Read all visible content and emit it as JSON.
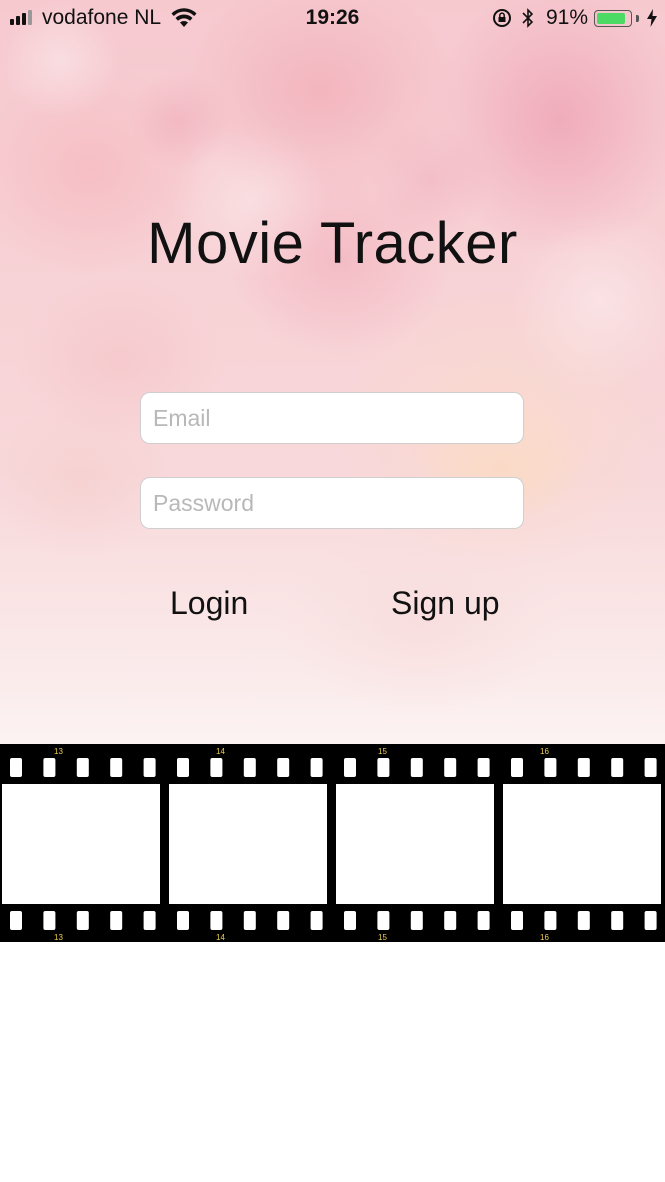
{
  "status_bar": {
    "carrier": "vodafone NL",
    "time": "19:26",
    "battery_percent": "91%",
    "battery_level": 0.91,
    "battery_color": "#4cd964",
    "icons": [
      "signal-icon",
      "wifi-icon",
      "rotation-lock-icon",
      "bluetooth-icon",
      "battery-icon",
      "charging-icon"
    ]
  },
  "app": {
    "title": "Movie Tracker"
  },
  "form": {
    "email_placeholder": "Email",
    "email_value": "",
    "password_placeholder": "Password",
    "password_value": ""
  },
  "actions": {
    "login_label": "Login",
    "signup_label": "Sign up"
  },
  "film_strip": {
    "frame_numbers": [
      "13",
      "14",
      "15",
      "16"
    ],
    "frame_number_color": "#f2d04a"
  }
}
